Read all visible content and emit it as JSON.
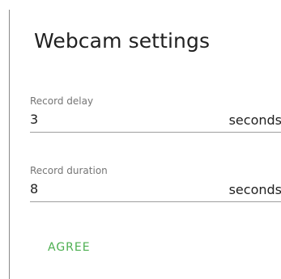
{
  "dialog": {
    "title": "Webcam settings"
  },
  "fields": {
    "record_delay": {
      "label": "Record delay",
      "value": "3",
      "suffix": "seconds"
    },
    "record_duration": {
      "label": "Record duration",
      "value": "8",
      "suffix": "seconds"
    }
  },
  "actions": {
    "agree_label": "AGREE"
  },
  "colors": {
    "accent": "#4caf50",
    "text": "#212121",
    "label": "#757575",
    "underline": "#9e9e9e"
  }
}
